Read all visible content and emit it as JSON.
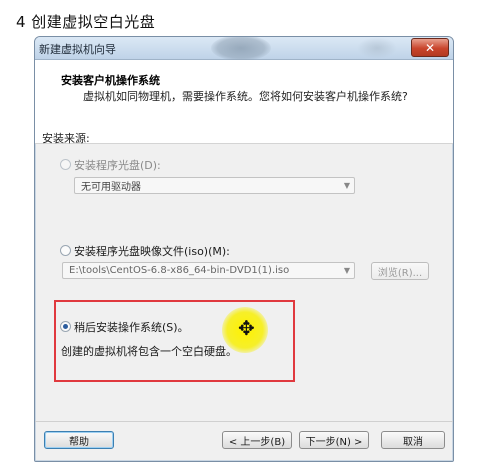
{
  "step_heading": "4   创建虚拟空白光盘",
  "window": {
    "title": "新建虚拟机向导",
    "close_glyph": "✕",
    "header_title": "安装客户机操作系统",
    "header_desc": "虚拟机如同物理机，需要操作系统。您将如何安装客户机操作系统?"
  },
  "install_source": {
    "label": "安装来源:",
    "options": [
      {
        "label": "安装程序光盘(D):",
        "selected": false,
        "enabled": false
      },
      {
        "label": "安装程序光盘映像文件(iso)(M):",
        "selected": false,
        "enabled": true
      },
      {
        "label": "稍后安装操作系统(S)。",
        "selected": true,
        "enabled": true
      }
    ],
    "disc_drive_value": "无可用驱动器",
    "iso_path_value": "E:\\tools\\CentOS-6.8-x86_64-bin-DVD1(1).iso",
    "browse_label": "浏览(R)...",
    "later_desc": "创建的虚拟机将包含一个空白硬盘。"
  },
  "footer": {
    "help_label": "帮助",
    "back_label": "< 上一步(B)",
    "next_label": "下一步(N) >",
    "cancel_label": "取消"
  },
  "icons": {
    "dropdown": "chevron-down-icon",
    "cursor": "move-cursor-icon"
  },
  "colors": {
    "highlight_box": "#e0393e",
    "cursor_halo": "#fff200",
    "radio_selected": "#2c5d9e"
  }
}
